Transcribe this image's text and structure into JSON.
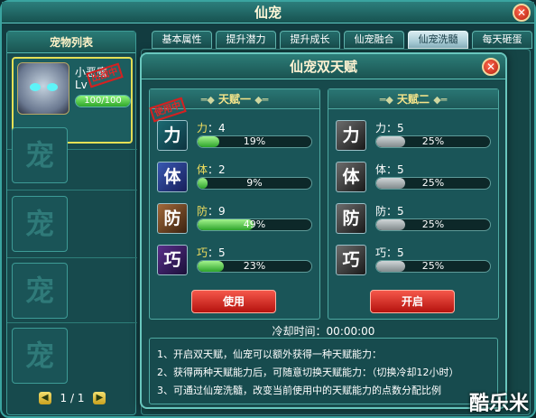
{
  "window": {
    "title": "仙宠",
    "close": "✕"
  },
  "sidebar": {
    "title": "宠物列表",
    "pet": {
      "name": "小恶魔",
      "level": "Lv",
      "stamp": "出战中",
      "hp_text": "100/100",
      "hp_fraction": 1.0
    },
    "empty_slot": "宠",
    "pager": {
      "prev": "◀",
      "text": "1 / 1",
      "next": "▶"
    }
  },
  "tabs": [
    {
      "label": "基本属性"
    },
    {
      "label": "提升潜力"
    },
    {
      "label": "提升成长"
    },
    {
      "label": "仙宠融合"
    },
    {
      "label": "仙宠洗髓"
    },
    {
      "label": "每天砸蛋"
    }
  ],
  "dialog": {
    "title": "仙宠双天赋",
    "close": "✕",
    "talent1": {
      "title": "天赋一",
      "stamp": "使用中",
      "button": "使用",
      "stats": [
        {
          "icon_text": "力",
          "key": "力",
          "value": "4",
          "percent": "19%",
          "fraction": 0.19
        },
        {
          "icon_text": "体",
          "key": "体",
          "value": "2",
          "percent": "9%",
          "fraction": 0.09
        },
        {
          "icon_text": "防",
          "key": "防",
          "value": "9",
          "percent": "49%",
          "fraction": 0.49
        },
        {
          "icon_text": "巧",
          "key": "巧",
          "value": "5",
          "percent": "23%",
          "fraction": 0.23
        }
      ]
    },
    "talent2": {
      "title": "天赋二",
      "button": "开启",
      "stats": [
        {
          "icon_text": "力",
          "key": "力",
          "value": "5",
          "percent": "25%",
          "fraction": 0.25
        },
        {
          "icon_text": "体",
          "key": "体",
          "value": "5",
          "percent": "25%",
          "fraction": 0.25
        },
        {
          "icon_text": "防",
          "key": "防",
          "value": "5",
          "percent": "25%",
          "fraction": 0.25
        },
        {
          "icon_text": "巧",
          "key": "巧",
          "value": "5",
          "percent": "25%",
          "fraction": 0.25
        }
      ]
    },
    "cooldown": "冷却时间：00:00:00",
    "info": [
      "1、开启双天赋，仙宠可以额外获得一种天赋能力：",
      "2、获得两种天赋能力后，可随意切换天赋能力：（切换冷却12小时）",
      "3、可通过仙宠洗髓，改变当前使用中的天赋能力的点数分配比例"
    ]
  },
  "watermark": "酷乐米"
}
